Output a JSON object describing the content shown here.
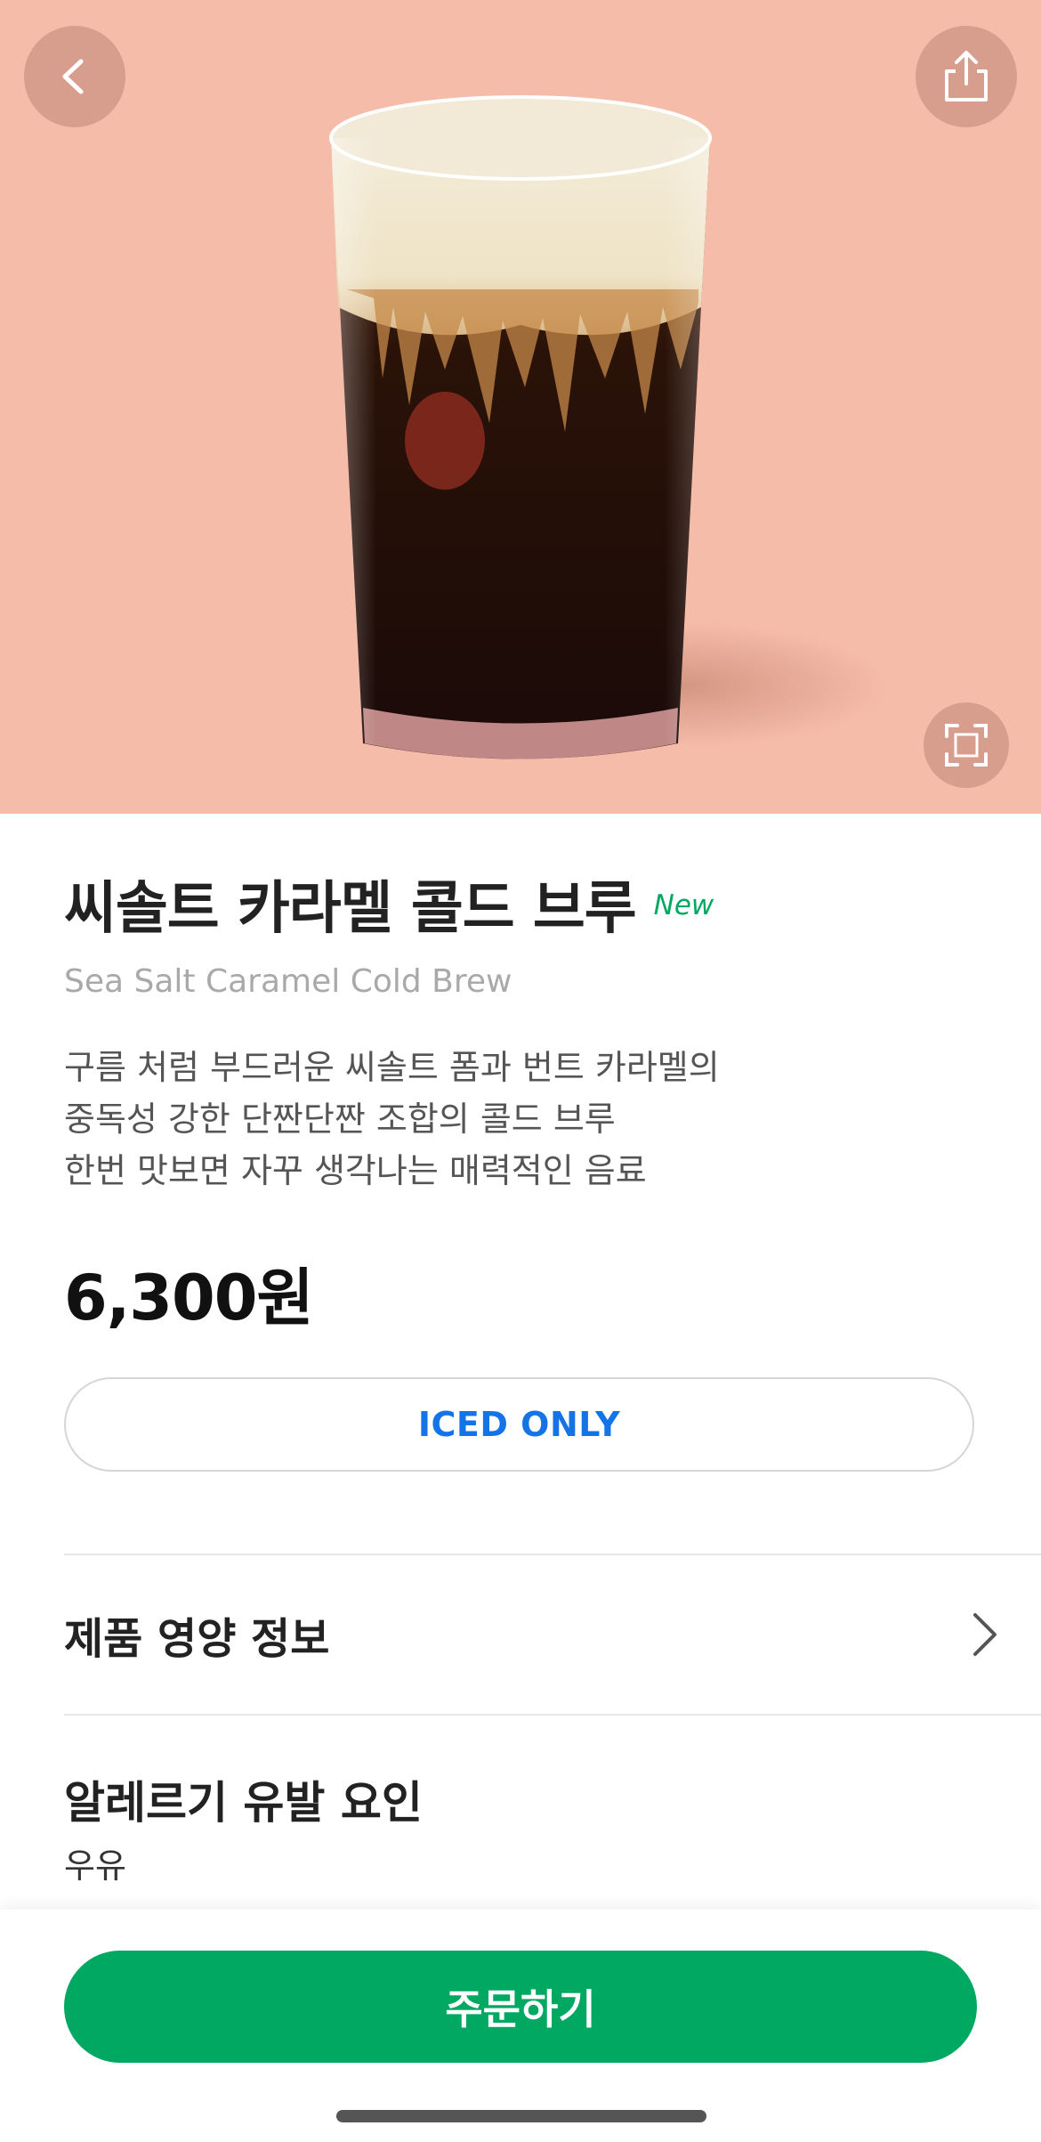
{
  "hero": {
    "background_color": "#f5bca9",
    "back_icon": "chevron-left-icon",
    "share_icon": "share-icon",
    "expand_icon": "expand-frame-icon",
    "image": "iced-coffee-glass-image"
  },
  "product": {
    "name_ko": "씨솔트 카라멜 콜드 브루",
    "badge": "New",
    "name_en": "Sea Salt Caramel Cold Brew",
    "description_lines": [
      "구름 처럼 부드러운 씨솔트 폼과 번트 카라멜의",
      "중독성 강한 단짠단짠 조합의 콜드 브루",
      "한번 맛보면 자꾸 생각나는 매력적인 음료"
    ],
    "price": "6,300원",
    "temperature_option": "ICED ONLY"
  },
  "sections": {
    "nutrition_label": "제품 영양 정보",
    "allergy_title": "알레르기 유발 요인",
    "allergy_value": "우유"
  },
  "bottom": {
    "order_label": "주문하기"
  },
  "colors": {
    "accent_green": "#00a862",
    "link_blue": "#1473e6"
  }
}
